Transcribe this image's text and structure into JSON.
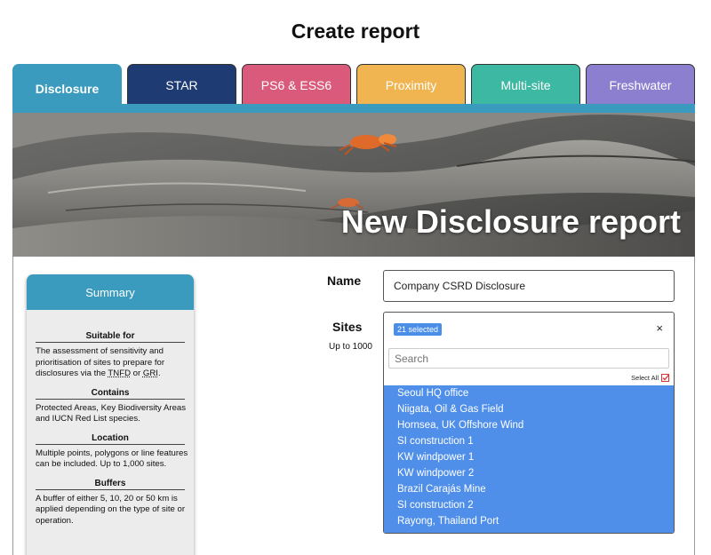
{
  "page_title": "Create report",
  "tabs": [
    {
      "label": "Disclosure",
      "color": "#3a9bbf",
      "active": true
    },
    {
      "label": "STAR",
      "color": "#1f3b73",
      "active": false
    },
    {
      "label": "PS6 & ESS6",
      "color": "#d95a7a",
      "active": false
    },
    {
      "label": "Proximity",
      "color": "#f0b451",
      "active": false
    },
    {
      "label": "Multi-site",
      "color": "#3cb8a3",
      "active": false
    },
    {
      "label": "Freshwater",
      "color": "#8c7fd0",
      "active": false
    }
  ],
  "hero": {
    "title": "New Disclosure report"
  },
  "summary": {
    "header": "Summary",
    "sections": [
      {
        "heading": "Suitable for",
        "text_pre": "The assessment of sensitivity and prioritisation of sites to prepare for disclosures via the ",
        "abbr1": "TNFD",
        "text_mid": " or ",
        "abbr2": "GRI",
        "text_post": "."
      },
      {
        "heading": "Contains",
        "text": "Protected Areas, Key Biodiversity Areas and IUCN Red List species."
      },
      {
        "heading": "Location",
        "text": "Multiple points, polygons or line features can be included. Up to 1,000 sites."
      },
      {
        "heading": "Buffers",
        "text": "A buffer of either 5, 10, 20 or 50 km is applied depending on the type of site or operation."
      }
    ]
  },
  "form": {
    "name_label": "Name",
    "name_value": "Company CSRD Disclosure",
    "sites_label": "Sites",
    "sites_hint": "Up to 1000",
    "selected_badge": "21 selected",
    "clear_symbol": "×",
    "search_placeholder": "Search",
    "select_all_label": "Select All",
    "sites": [
      "Seoul HQ office",
      "Niigata, Oil & Gas Field",
      "Hornsea, UK Offshore Wind",
      "SI construction 1",
      "KW windpower 1",
      "KW windpower 2",
      "Brazil Carajás Mine",
      "SI construction 2",
      "Rayong, Thailand Port"
    ]
  }
}
